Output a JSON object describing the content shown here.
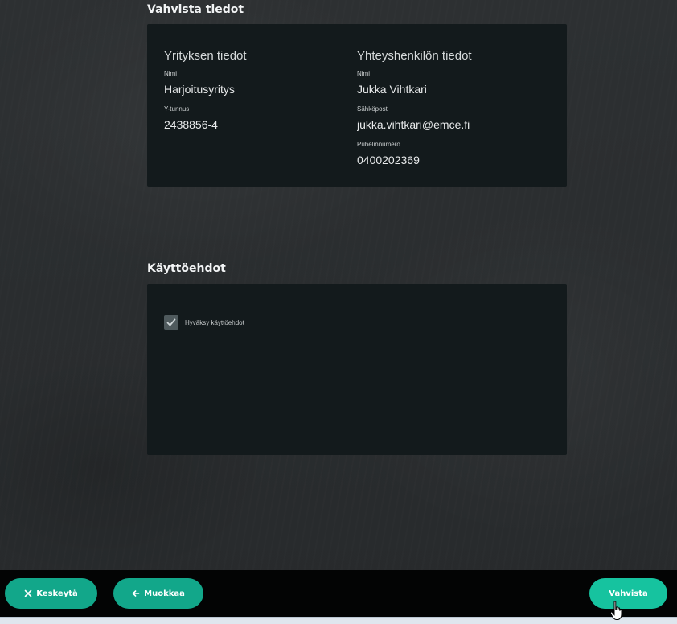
{
  "confirm_section": {
    "title": "Vahvista tiedot",
    "company": {
      "heading": "Yrityksen tiedot",
      "name_label": "Nimi",
      "name_value": "Harjoitusyritys",
      "business_id_label": "Y-tunnus",
      "business_id_value": "2438856-4"
    },
    "contact": {
      "heading": "Yhteyshenkilön tiedot",
      "name_label": "Nimi",
      "name_value": "Jukka Vihtkari",
      "email_label": "Sähköposti",
      "email_value": "jukka.vihtkari@emce.fi",
      "phone_label": "Puhelinnumero",
      "phone_value": "0400202369"
    }
  },
  "terms_section": {
    "title": "Käyttöehdot",
    "accept_label": "Hyväksy käyttöehdot",
    "accepted": true
  },
  "footer": {
    "cancel_label": "Keskeytä",
    "edit_label": "Muokkaa",
    "confirm_label": "Vahvista"
  },
  "colors": {
    "accent": "#12a78a",
    "accent_bright": "#16c39f",
    "card_bg": "#131a1c",
    "footer_bg": "#030404"
  },
  "icons": {
    "cancel": "close-icon",
    "edit": "arrow-left-icon",
    "checkbox": "check-icon"
  }
}
